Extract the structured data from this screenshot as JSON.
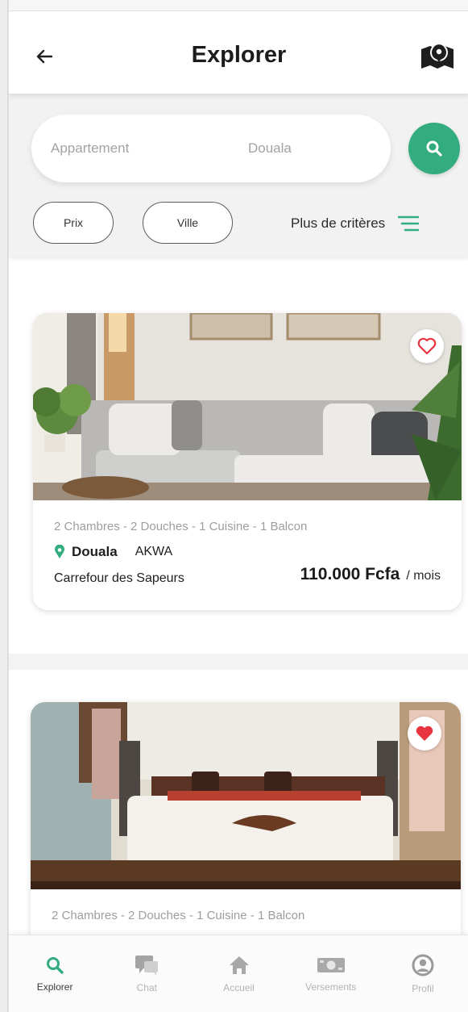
{
  "header": {
    "title": "Explorer",
    "back_icon": "arrow-left-icon",
    "map_icon": "map-pin-icon"
  },
  "search": {
    "type_placeholder": "Appartement",
    "city_placeholder": "Douala"
  },
  "filters": {
    "chips": [
      "Prix",
      "Ville"
    ],
    "more_label": "Plus de critères"
  },
  "listings": [
    {
      "features": "2 Chambres - 2 Douches - 1 Cuisine - 1 Balcon",
      "city": "Douala",
      "district": "AKWA",
      "street": "Carrefour des Sapeurs",
      "price": "110.000 Fcfa",
      "per": "/ mois",
      "favorite": false
    },
    {
      "features": "2 Chambres - 2 Douches - 1 Cuisine - 1 Balcon",
      "favorite": true
    }
  ],
  "bottom_nav": [
    {
      "label": "Explorer",
      "icon": "search-icon",
      "active": true
    },
    {
      "label": "Chat",
      "icon": "chat-icon",
      "active": false
    },
    {
      "label": "Accueil",
      "icon": "home-icon",
      "active": false
    },
    {
      "label": "Versements",
      "icon": "banknote-icon",
      "active": false
    },
    {
      "label": "Profil",
      "icon": "user-icon",
      "active": false
    }
  ],
  "colors": {
    "accent": "#33ad7f",
    "heart": "#e8343e"
  }
}
